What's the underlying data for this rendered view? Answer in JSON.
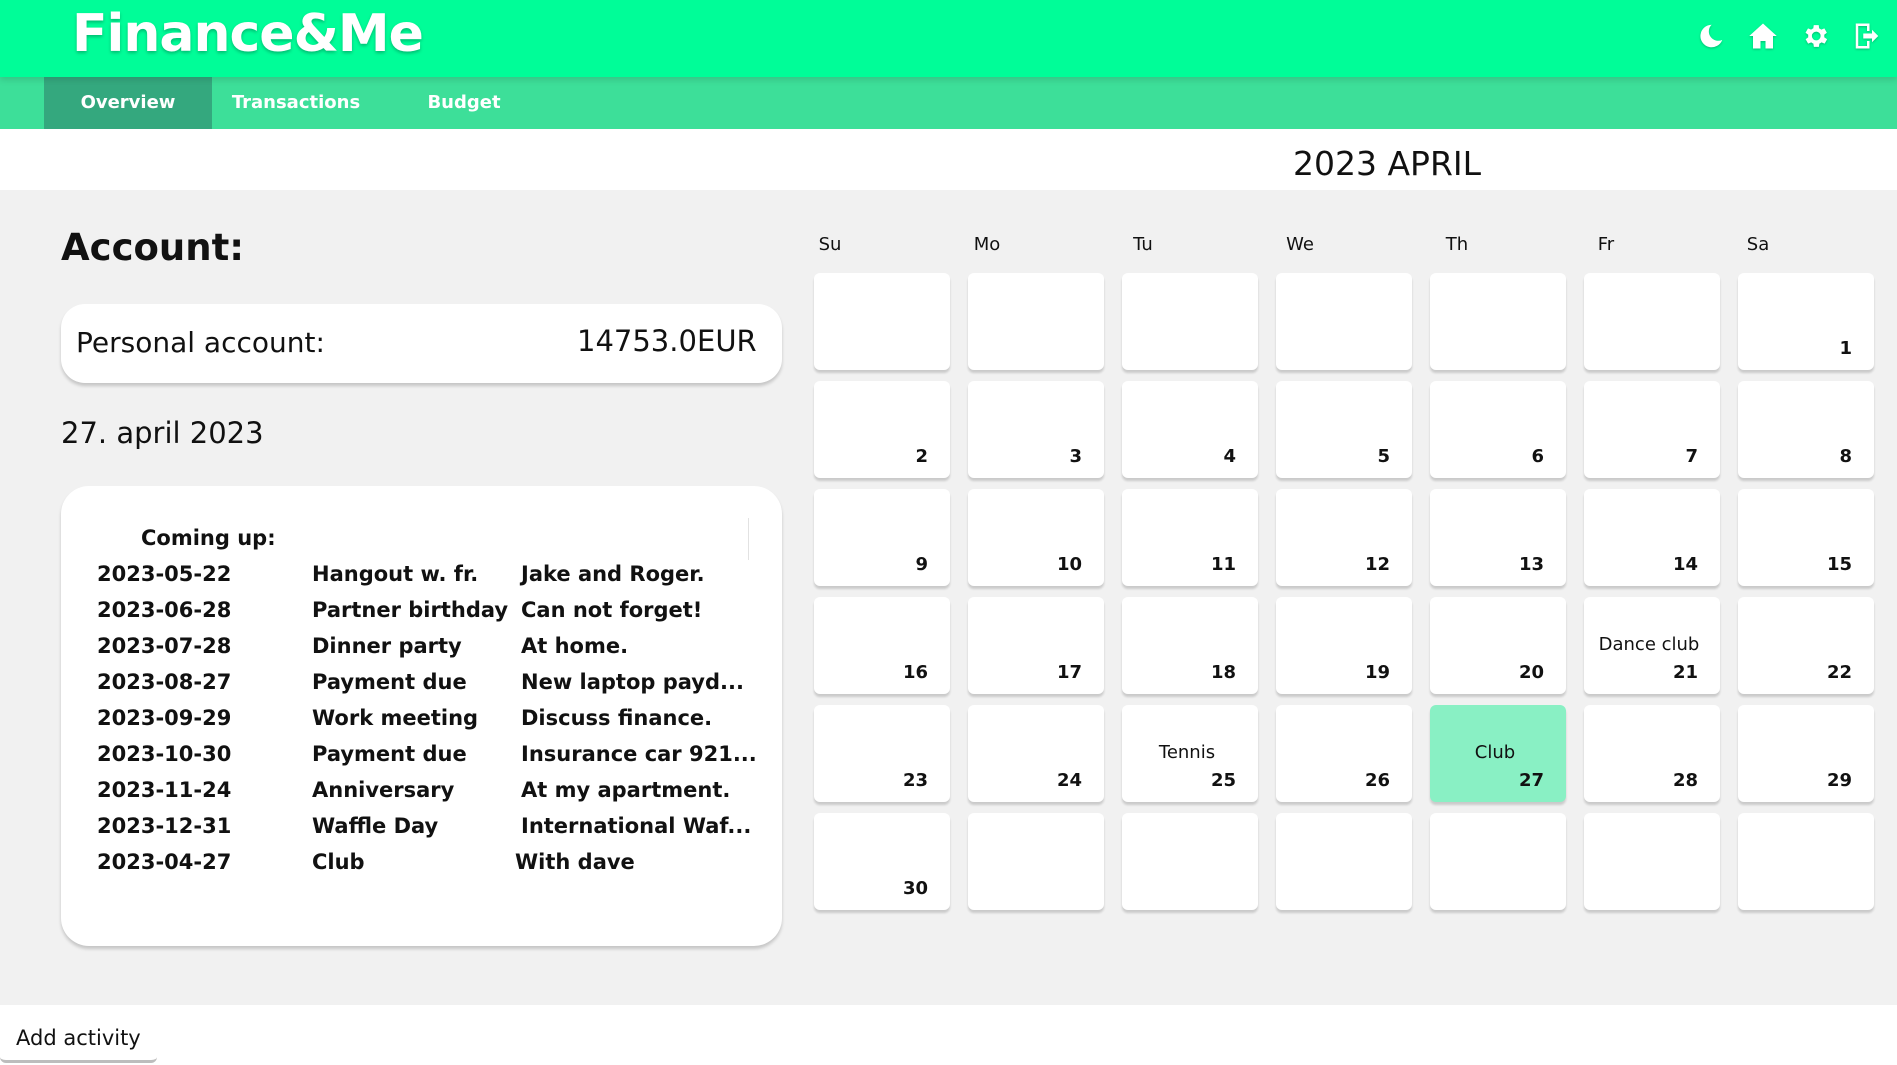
{
  "app": {
    "logo": "Finance&Me"
  },
  "header_icons": [
    "moon-icon",
    "home-icon",
    "gear-icon",
    "logout-icon"
  ],
  "nav": {
    "tabs": [
      {
        "label": "Overview",
        "active": true
      },
      {
        "label": "Transactions",
        "active": false
      },
      {
        "label": "Budget",
        "active": false
      }
    ]
  },
  "account": {
    "heading": "Account:",
    "label": "Personal account:",
    "amount": "14753.0",
    "currency": "EUR"
  },
  "today": "27. april 2023",
  "upcoming": {
    "title": "Coming up:",
    "items": [
      {
        "date": "2023-05-22",
        "title": "Hangout w. fr.",
        "desc": "Jake and Roger."
      },
      {
        "date": "2023-06-28",
        "title": "Partner birthday",
        "desc": "Can not forget!"
      },
      {
        "date": "2023-07-28",
        "title": "Dinner party",
        "desc": "At home."
      },
      {
        "date": "2023-08-27",
        "title": "Payment due",
        "desc": "New laptop payd..."
      },
      {
        "date": "2023-09-29",
        "title": "Work meeting",
        "desc": "Discuss finance."
      },
      {
        "date": "2023-10-30",
        "title": "Payment due",
        "desc": "Insurance car 921..."
      },
      {
        "date": "2023-11-24",
        "title": "Anniversary",
        "desc": "At my apartment."
      },
      {
        "date": "2023-12-31",
        "title": "Waffle Day",
        "desc": "International Waf..."
      },
      {
        "date": "2023-04-27",
        "title": "Club",
        "desc": "With dave"
      }
    ]
  },
  "calendar": {
    "title": "2023 APRIL",
    "weekdays": [
      "Su",
      "Mo",
      "Tu",
      "We",
      "Th",
      "Fr",
      "Sa"
    ],
    "days": [
      "",
      "",
      "",
      "",
      "",
      "",
      "1",
      "2",
      "3",
      "4",
      "5",
      "6",
      "7",
      "8",
      "9",
      "10",
      "11",
      "12",
      "13",
      "14",
      "15",
      "16",
      "17",
      "18",
      "19",
      "20",
      "21",
      "22",
      "23",
      "24",
      "25",
      "26",
      "27",
      "28",
      "29",
      "30",
      "",
      "",
      "",
      "",
      "",
      ""
    ],
    "events": {
      "21": "Dance club",
      "25": "Tennis",
      "27": "Club"
    },
    "highlighted_day": "27",
    "highlight_color": "#89f0c4"
  },
  "footer": {
    "add_activity": "Add activity"
  },
  "colors": {
    "header": "#00fd98",
    "nav": "#3ddf99",
    "nav_active": "#34a87e"
  }
}
